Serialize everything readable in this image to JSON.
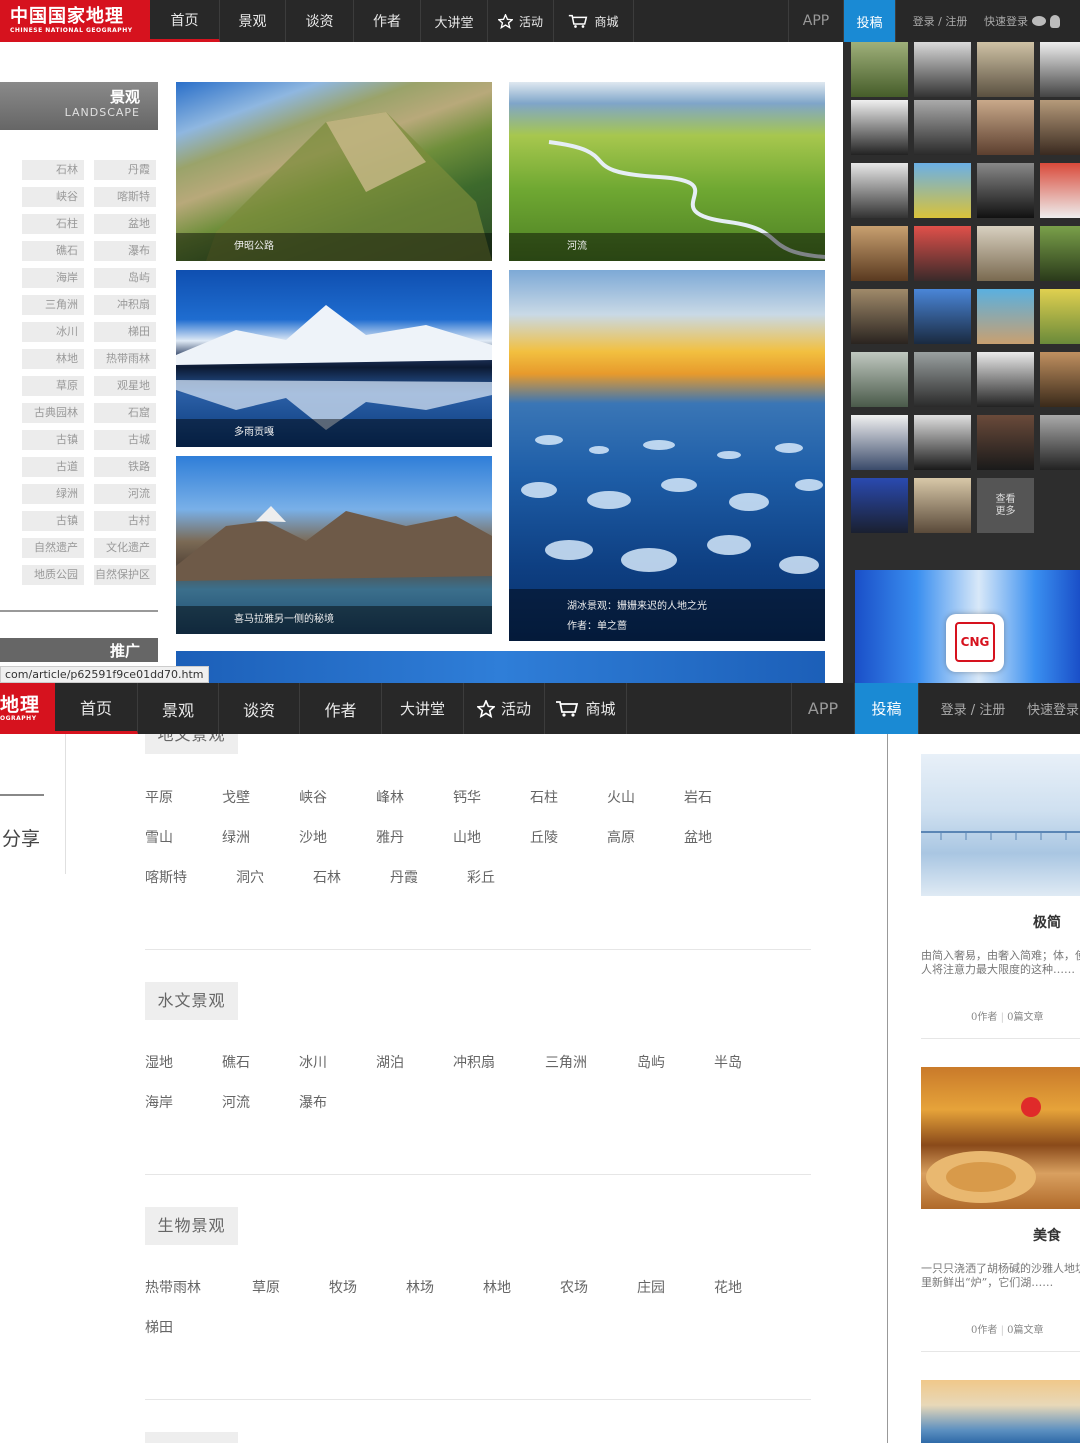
{
  "nav1": {
    "logo_main": "中国国家地理",
    "logo_sub": "CHINESE NATIONAL GEOGRAPHY",
    "items": [
      "首页",
      "景观",
      "谈资",
      "作者",
      "大讲堂",
      "活动",
      "商城"
    ],
    "app": "APP",
    "submit": "投稿",
    "login": "登录 / 注册",
    "quick_login": "快速登录"
  },
  "nav2": {
    "logo_main": "地理",
    "logo_sub": "OGRAPHY",
    "items": [
      "首页",
      "景观",
      "谈资",
      "作者",
      "大讲堂",
      "活动",
      "商城"
    ],
    "app": "APP",
    "submit": "投稿",
    "login": "登录 / 注册",
    "quick_login": "快速登录"
  },
  "landscape": {
    "title": "景观",
    "title_en": "LANDSCAPE",
    "tags": [
      "石林",
      "丹霞",
      "峡谷",
      "喀斯特",
      "石柱",
      "盆地",
      "礁石",
      "瀑布",
      "海岸",
      "岛屿",
      "三角洲",
      "冲积扇",
      "冰川",
      "梯田",
      "林地",
      "热带雨林",
      "草原",
      "观星地",
      "古典园林",
      "石窟",
      "古镇",
      "古城",
      "古道",
      "铁路",
      "绿洲",
      "河流",
      "古镇",
      "古村",
      "自然遗产",
      "文化遗产",
      "地质公园",
      "自然保护区"
    ],
    "promo": "推广"
  },
  "photos": [
    {
      "caption": "伊昭公路"
    },
    {
      "caption": "河流"
    },
    {
      "caption": "多雨贡嘎"
    },
    {
      "caption": "喜马拉雅另一侧的秘境"
    },
    {
      "caption": "湖冰景观：姗姗来迟的人地之光",
      "author": "作者：单之蔷"
    }
  ],
  "more_authors": "查看\n更多",
  "status_url": "com/article/p62591f9ce01dd70.htm",
  "share": "分享",
  "sections": [
    {
      "title": "地文景观",
      "keywords": [
        "平原",
        "戈壁",
        "峡谷",
        "峰林",
        "钙华",
        "石柱",
        "火山",
        "岩石",
        "雪山",
        "绿洲",
        "沙地",
        "雅丹",
        "山地",
        "丘陵",
        "高原",
        "盆地",
        "喀斯特",
        "洞穴",
        "石林",
        "丹霞",
        "彩丘"
      ]
    },
    {
      "title": "水文景观",
      "keywords": [
        "湿地",
        "礁石",
        "冰川",
        "湖泊",
        "冲积扇",
        "三角洲",
        "岛屿",
        "半岛",
        "海岸",
        "河流",
        "瀑布"
      ]
    },
    {
      "title": "生物景观",
      "keywords": [
        "热带雨林",
        "草原",
        "牧场",
        "林场",
        "林地",
        "农场",
        "庄园",
        "花地",
        "梯田"
      ]
    }
  ],
  "cards": [
    {
      "title": "极简",
      "desc": "由简入奢易，由奢入简难；体，使人将注意力最大限度的这种……",
      "authors": "0作者",
      "articles": "0篇文章"
    },
    {
      "title": "美食",
      "desc": "一只只浇洒了胡杨碱的沙雅人地坑里新鲜出“炉”，它们湖……",
      "authors": "0作者",
      "articles": "0篇文章"
    }
  ],
  "colors": {
    "brand_red": "#d6121e",
    "nav_bg": "#282828",
    "submit_blue": "#1a8ad4"
  }
}
